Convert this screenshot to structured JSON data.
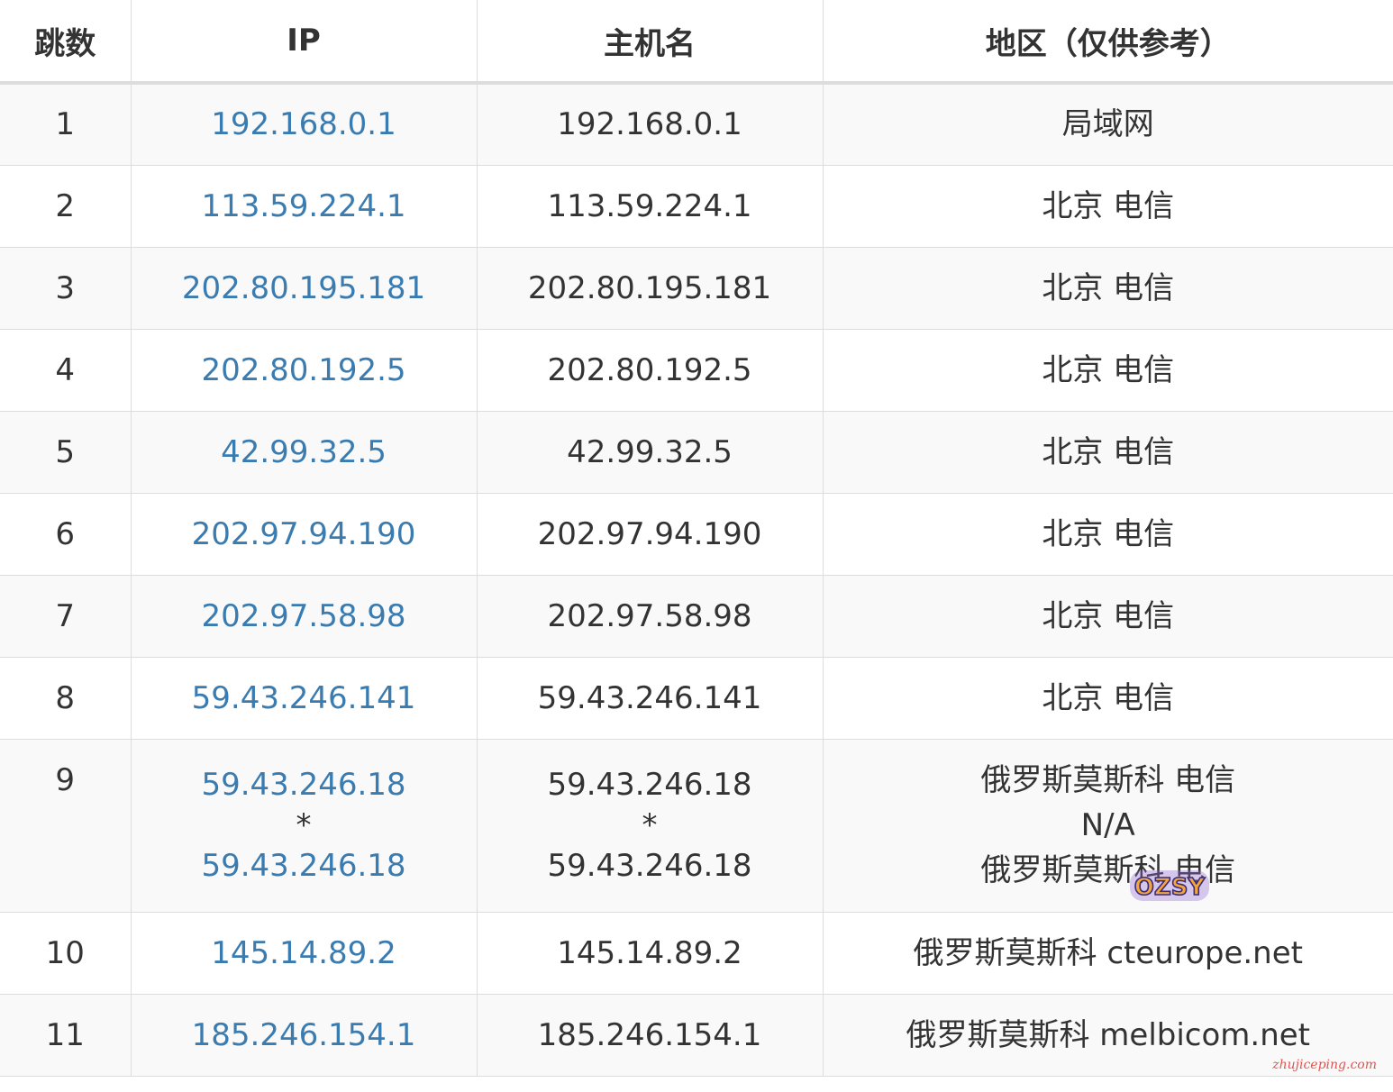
{
  "table": {
    "headers": {
      "hop": "跳数",
      "ip": "IP",
      "host": "主机名",
      "region": "地区（仅供参考）"
    },
    "rows": [
      {
        "hop": "1",
        "ip": [
          "192.168.0.1"
        ],
        "host": [
          "192.168.0.1"
        ],
        "region": [
          "局域网"
        ]
      },
      {
        "hop": "2",
        "ip": [
          "113.59.224.1"
        ],
        "host": [
          "113.59.224.1"
        ],
        "region": [
          "北京 电信"
        ]
      },
      {
        "hop": "3",
        "ip": [
          "202.80.195.181"
        ],
        "host": [
          "202.80.195.181"
        ],
        "region": [
          "北京 电信"
        ]
      },
      {
        "hop": "4",
        "ip": [
          "202.80.192.5"
        ],
        "host": [
          "202.80.192.5"
        ],
        "region": [
          "北京 电信"
        ]
      },
      {
        "hop": "5",
        "ip": [
          "42.99.32.5"
        ],
        "host": [
          "42.99.32.5"
        ],
        "region": [
          "北京 电信"
        ]
      },
      {
        "hop": "6",
        "ip": [
          "202.97.94.190"
        ],
        "host": [
          "202.97.94.190"
        ],
        "region": [
          "北京 电信"
        ]
      },
      {
        "hop": "7",
        "ip": [
          "202.97.58.98"
        ],
        "host": [
          "202.97.58.98"
        ],
        "region": [
          "北京 电信"
        ]
      },
      {
        "hop": "8",
        "ip": [
          "59.43.246.141"
        ],
        "host": [
          "59.43.246.141"
        ],
        "region": [
          "北京 电信"
        ]
      },
      {
        "hop": "9",
        "ip": [
          "59.43.246.18",
          "*",
          "59.43.246.18"
        ],
        "host": [
          "59.43.246.18",
          "*",
          "59.43.246.18"
        ],
        "region": [
          "俄罗斯莫斯科 电信",
          "N/A",
          "俄罗斯莫斯科 电信"
        ]
      },
      {
        "hop": "10",
        "ip": [
          "145.14.89.2"
        ],
        "host": [
          "145.14.89.2"
        ],
        "region": [
          "俄罗斯莫斯科 cteurope.net"
        ]
      },
      {
        "hop": "11",
        "ip": [
          "185.246.154.1"
        ],
        "host": [
          "185.246.154.1"
        ],
        "region": [
          "俄罗斯莫斯科 melbicom.net"
        ]
      }
    ]
  },
  "watermark": {
    "logo_text": "OZSY",
    "site_text": "zhujiceping.com"
  },
  "colors": {
    "link": "#3a7bb0",
    "text": "#333333",
    "stripe": "#f9f9f9",
    "border": "#dddddd"
  }
}
